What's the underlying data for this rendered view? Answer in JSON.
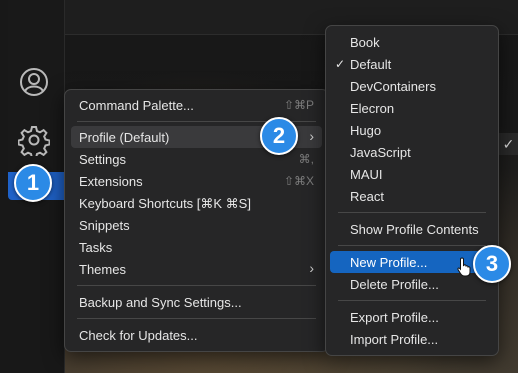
{
  "main_menu": {
    "items": [
      {
        "label": "Command Palette...",
        "shortcut": "⇧⌘P"
      },
      {
        "label": "Profile (Default)"
      },
      {
        "label": "Settings",
        "shortcut": "⌘,"
      },
      {
        "label": "Extensions",
        "shortcut": "⇧⌘X"
      },
      {
        "label": "Keyboard Shortcuts [⌘K ⌘S]"
      },
      {
        "label": "Snippets"
      },
      {
        "label": "Tasks"
      },
      {
        "label": "Themes"
      },
      {
        "label": "Backup and Sync Settings..."
      },
      {
        "label": "Check for Updates..."
      }
    ]
  },
  "profile_menu": {
    "profiles": [
      "Book",
      "Default",
      "DevContainers",
      "Elecron",
      "Hugo",
      "JavaScript",
      "MAUI",
      "React"
    ],
    "checked": "Default",
    "actions": [
      "Show Profile Contents",
      "New Profile...",
      "Delete Profile...",
      "Export Profile...",
      "Import Profile..."
    ]
  },
  "badges": [
    "1",
    "2",
    "3"
  ],
  "icons": {
    "accounts": "accounts-icon",
    "manage": "gear-icon",
    "submenu": "chevron-right-icon",
    "check": "checkmark-icon",
    "cursor": "hand-pointer-icon"
  },
  "colors": {
    "accent": "#1565c0",
    "badge": "#2b8ae6",
    "menu_bg": "#262627"
  }
}
